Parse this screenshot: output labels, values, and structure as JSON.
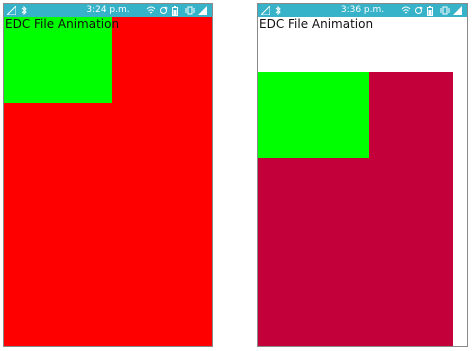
{
  "statusbar": {
    "color": "#36b3c9",
    "left_icons": [
      "signal-icon",
      "bluetooth-icon"
    ],
    "right_icons": [
      "wifi-icon",
      "sync-icon",
      "battery-icon",
      "vibrate-icon",
      "cellular-icon"
    ]
  },
  "screens": [
    {
      "time": "3:24 p.m.",
      "title": "EDC File Animation",
      "background_rect_color": "#ff0000",
      "foreground_rect_color": "#00ff00"
    },
    {
      "time": "3:36 p.m.",
      "title": "EDC File Animation",
      "background_rect_color": "#c4003a",
      "foreground_rect_color": "#00ff00"
    }
  ]
}
